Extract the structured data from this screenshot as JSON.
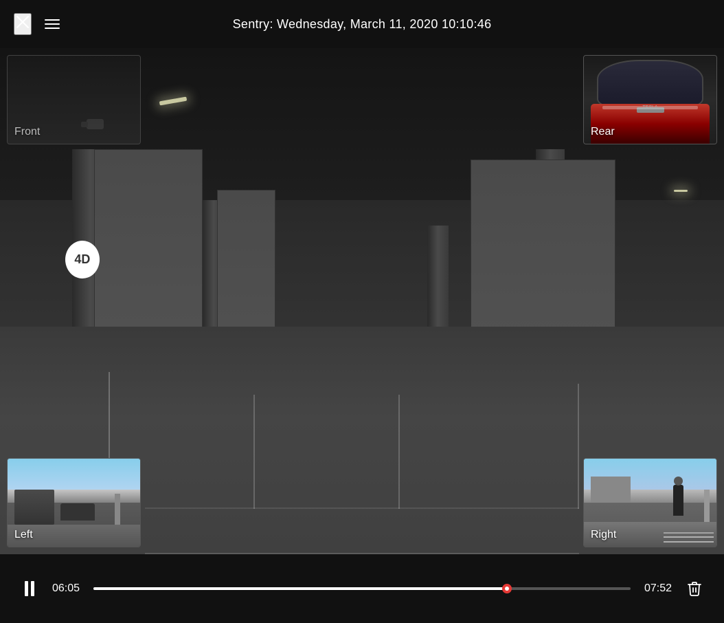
{
  "header": {
    "title": "Sentry: Wednesday, March 11, 2020 10:10:46",
    "close_label": "×",
    "menu_label": "menu"
  },
  "cameras": {
    "front_label": "Front",
    "rear_label": "Rear",
    "left_label": "Left",
    "right_label": "Right"
  },
  "controls": {
    "current_time": "06:05",
    "total_time": "07:52",
    "progress_percent": 77,
    "pause_label": "pause",
    "delete_label": "delete"
  },
  "icons": {
    "close": "✕",
    "pause_bar1": "",
    "pause_bar2": ""
  }
}
